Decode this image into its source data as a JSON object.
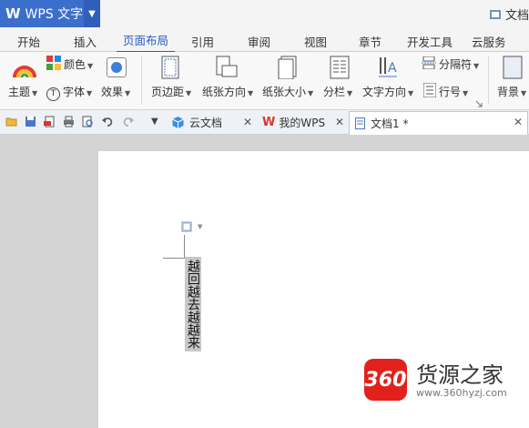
{
  "app": {
    "logo": "W",
    "name": "WPS 文字",
    "title_right": "文档"
  },
  "ribbon_tabs": [
    "开始",
    "插入",
    "页面布局",
    "引用",
    "审阅",
    "视图",
    "章节",
    "开发工具",
    "云服务"
  ],
  "active_tab": "页面布局",
  "ribbon": {
    "theme": "主题",
    "colors": "颜色",
    "fonts": "字体",
    "effects": "效果",
    "margins": "页边距",
    "orientation": "纸张方向",
    "size": "纸张大小",
    "columns": "分栏",
    "text_direction": "文字方向",
    "breaks": "分隔符",
    "line_numbers": "行号",
    "background": "背景"
  },
  "doc_tabs": [
    {
      "label": "云文档",
      "icon": "cloud-cube-icon"
    },
    {
      "label": "我的WPS",
      "icon": "wps-logo-icon"
    },
    {
      "label": "文档1 *",
      "icon": "document-icon",
      "active": true
    }
  ],
  "document": {
    "vertical_text": "越回越去越越来"
  },
  "watermark": {
    "logo_text": "360",
    "name": "货源之家",
    "url": "www.360hyzj.com"
  },
  "colors": {
    "accent": "#2a5cc6",
    "wps_blue": "#3c6fcb",
    "logo_red": "#e2211c"
  }
}
